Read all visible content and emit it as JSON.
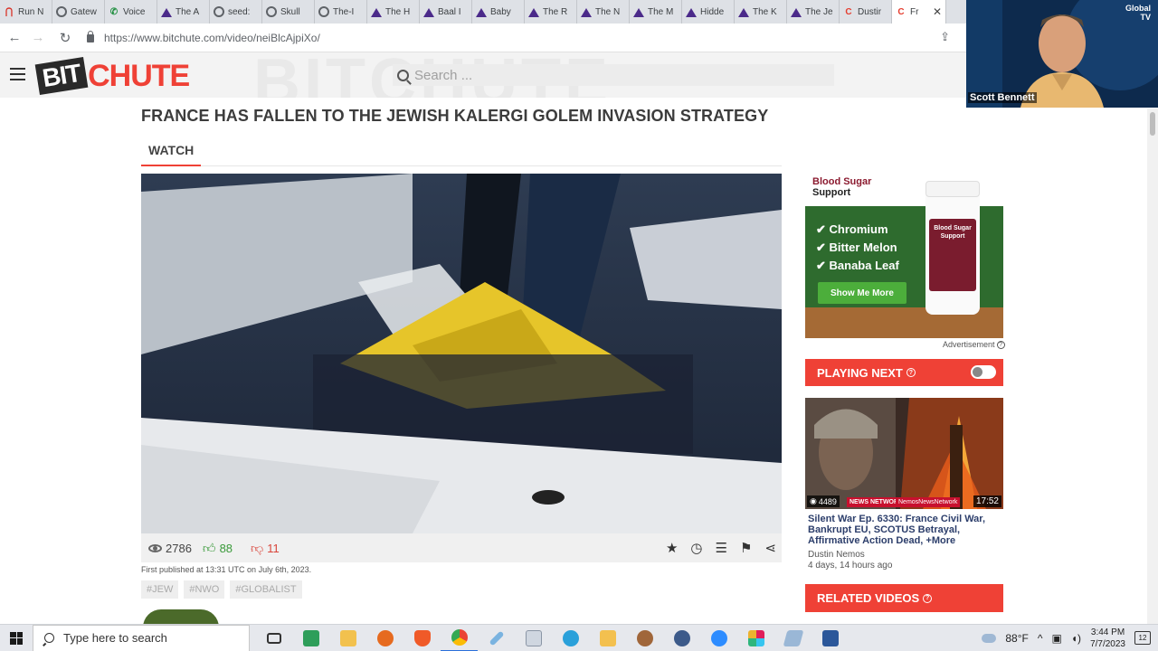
{
  "browser": {
    "tabs": [
      {
        "label": "Run N",
        "icon": "m"
      },
      {
        "label": "Gatew",
        "icon": "g"
      },
      {
        "label": "Voice",
        "icon": "v"
      },
      {
        "label": "The A",
        "icon": "a"
      },
      {
        "label": "seed:",
        "icon": "g"
      },
      {
        "label": "Skull",
        "icon": "g"
      },
      {
        "label": "The-I",
        "icon": "g"
      },
      {
        "label": "The H",
        "icon": "a"
      },
      {
        "label": "Baal I",
        "icon": "a"
      },
      {
        "label": "Baby",
        "icon": "a"
      },
      {
        "label": "The R",
        "icon": "a"
      },
      {
        "label": "The N",
        "icon": "a"
      },
      {
        "label": "The M",
        "icon": "a"
      },
      {
        "label": "Hidde",
        "icon": "a"
      },
      {
        "label": "The K",
        "icon": "a"
      },
      {
        "label": "The Je",
        "icon": "a"
      },
      {
        "label": "Dustir",
        "icon": "b"
      }
    ],
    "active_tab": {
      "label": "Fr",
      "close": "✕"
    },
    "url": "https://www.bitchute.com/video/neiBlcAjpiXo/",
    "back": "←",
    "forward": "→",
    "reload": "↻",
    "share": "⇪"
  },
  "site": {
    "logo_left": "BIT",
    "logo_right": "CHUTE",
    "watermark": "BITCHUTE",
    "search_placeholder": "Search ..."
  },
  "video": {
    "title": "FRANCE HAS FALLEN TO THE JEWISH KALERGI GOLEM INVASION STRATEGY",
    "tab_watch": "WATCH",
    "views": "2786",
    "likes": "88",
    "dislikes": "11",
    "published": "First published at 13:31 UTC on July 6th, 2023.",
    "tags": [
      "#JEW",
      "#NWO",
      "#GLOBALIST"
    ],
    "actions": [
      "favorite-star-icon",
      "watch-later-clock-icon",
      "playlist-icon",
      "flag-icon",
      "share-icon"
    ]
  },
  "ad": {
    "title_line1": "Blood Sugar",
    "title_line2": "Support",
    "items": [
      "✔ Chromium",
      "✔ Bitter Melon",
      "✔ Banaba Leaf"
    ],
    "button": "Show Me More",
    "bottle_label": "Blood Sugar Support",
    "label": "Advertisement"
  },
  "playing_next": {
    "header": "PLAYING NEXT",
    "views": "4489",
    "banner": "NEWS NETWORK",
    "banner2": "NemosNewsNetwork",
    "duration": "17:52",
    "title": "Silent War Ep. 6330: France Civil War, Bankrupt EU, SCOTUS Betrayal, Affirmative Action Dead, +More",
    "channel": "Dustin Nemos",
    "age": "4 days, 14 hours ago"
  },
  "related": {
    "header": "RELATED VIDEOS"
  },
  "webcam": {
    "name": "Scott Bennett",
    "logo_line1": "Global",
    "logo_line2": "TV"
  },
  "taskbar": {
    "search_placeholder": "Type here to search",
    "temperature": "88°F",
    "time": "3:44 PM",
    "date": "7/7/2023",
    "notifications": "12"
  },
  "colors": {
    "brand_red": "#ef4136",
    "ad_green": "#2e6b2e",
    "taskbar": "#e6e8ed"
  }
}
